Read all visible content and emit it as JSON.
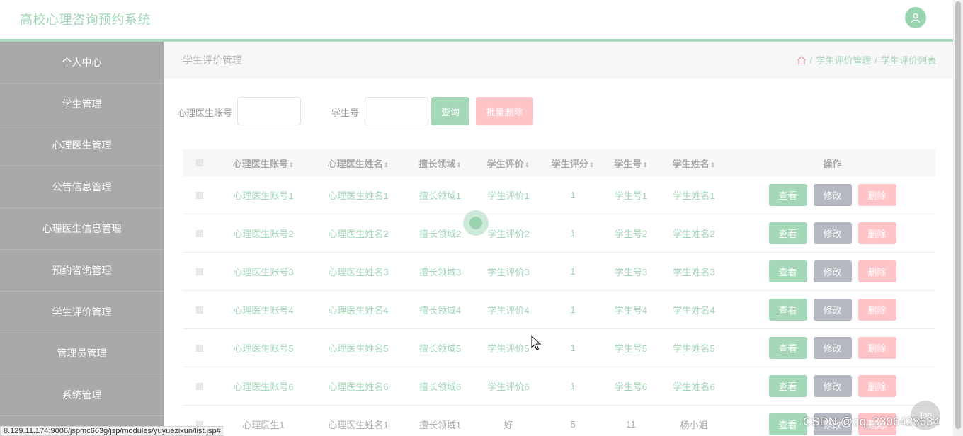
{
  "header": {
    "title": "高校心理咨询预约系统",
    "avatar_icon": "user-icon"
  },
  "sidebar": {
    "items": [
      {
        "label": "个人中心"
      },
      {
        "label": "学生管理"
      },
      {
        "label": "心理医生管理"
      },
      {
        "label": "公告信息管理"
      },
      {
        "label": "心理医生信息管理"
      },
      {
        "label": "预约咨询管理"
      },
      {
        "label": "学生评价管理"
      },
      {
        "label": "管理员管理"
      },
      {
        "label": "系统管理"
      }
    ]
  },
  "main": {
    "page_title": "学生评价管理",
    "breadcrumb": {
      "home_icon": "home-icon",
      "sep": "/",
      "level1": "学生评价管理",
      "level2": "学生评价列表"
    },
    "search": {
      "doctor_account_label": "心理医生账号",
      "doctor_account_value": "",
      "student_no_label": "学生号",
      "student_no_value": "",
      "query_label": "查询",
      "batch_delete_label": "批量删除"
    },
    "table": {
      "headers": [
        "心理医生账号",
        "心理医生姓名",
        "擅长领域",
        "学生评价",
        "学生评分",
        "学生号",
        "学生姓名",
        "操作"
      ],
      "sort_icon": "⇕",
      "rows": [
        [
          "心理医生账号1",
          "心理医生姓名1",
          "擅长领域1",
          "学生评价1",
          "1",
          "学生号1",
          "学生姓名1"
        ],
        [
          "心理医生账号2",
          "心理医生姓名2",
          "擅长领域2",
          "学生评价2",
          "1",
          "学生号2",
          "学生姓名2"
        ],
        [
          "心理医生账号3",
          "心理医生姓名3",
          "擅长领域3",
          "学生评价3",
          "1",
          "学生号3",
          "学生姓名3"
        ],
        [
          "心理医生账号4",
          "心理医生姓名4",
          "擅长领域4",
          "学生评价4",
          "1",
          "学生号4",
          "学生姓名4"
        ],
        [
          "心理医生账号5",
          "心理医生姓名5",
          "擅长领域5",
          "学生评价5",
          "1",
          "学生号5",
          "学生姓名5"
        ],
        [
          "心理医生账号6",
          "心理医生姓名6",
          "擅长领域6",
          "学生评价6",
          "1",
          "学生号6",
          "学生姓名6"
        ],
        [
          "心理医生1",
          "心理医生姓名1",
          "擅长领域1",
          "好",
          "5",
          "11",
          "杨小姐"
        ]
      ],
      "actions": {
        "view": "查看",
        "edit": "修改",
        "delete": "删除"
      }
    }
  },
  "status_url": "8.129.11.174:9006/jspmc663g/jsp/modules/yuyuezixun/list.jsp#",
  "watermark": "CSDN @qq_3306428634",
  "back_to_top": "Top",
  "colors": {
    "accent": "#a4d8b8",
    "danger": "#ffc4c8",
    "neutral": "#b7b9c2",
    "sidebar": "#a9a9a9"
  }
}
